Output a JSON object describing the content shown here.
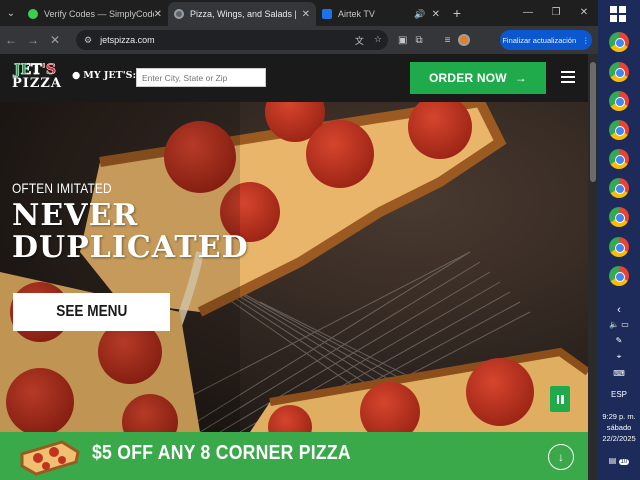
{
  "tabs": [
    {
      "title": "Verify Codes — SimplyCodes",
      "favicon_color": "#3ccf4e"
    },
    {
      "title": "Pizza, Wings, and Salads | Jet's",
      "favicon_color": "#9aa0a6",
      "active": true
    },
    {
      "title": "Airtek TV",
      "favicon_color": "#1a73e8"
    }
  ],
  "toolbar": {
    "url": "jetspizza.com",
    "update_label": "Finalizar actualización"
  },
  "site": {
    "logo_top": "JET'S",
    "logo_bottom": "PIZZA",
    "my_jets_label": "MY JET'S:",
    "location_placeholder": "Enter City, State or Zip",
    "order_now_label": "ORDER NOW",
    "brand_green": "#1faa4b",
    "brand_red": "#d7262e"
  },
  "hero": {
    "eyebrow": "OFTEN IMITATED",
    "headline_line1": "NEVER",
    "headline_line2": "DUPLICATED",
    "cta_label": "SEE MENU"
  },
  "promo": {
    "text": "$5 OFF ANY 8 CORNER PIZZA",
    "color": "#39a94a"
  },
  "taskbar": {
    "language": "ESP",
    "time": "9:29 p. m.",
    "day": "sábado",
    "date": "22/2/2025",
    "notifications": "10"
  }
}
